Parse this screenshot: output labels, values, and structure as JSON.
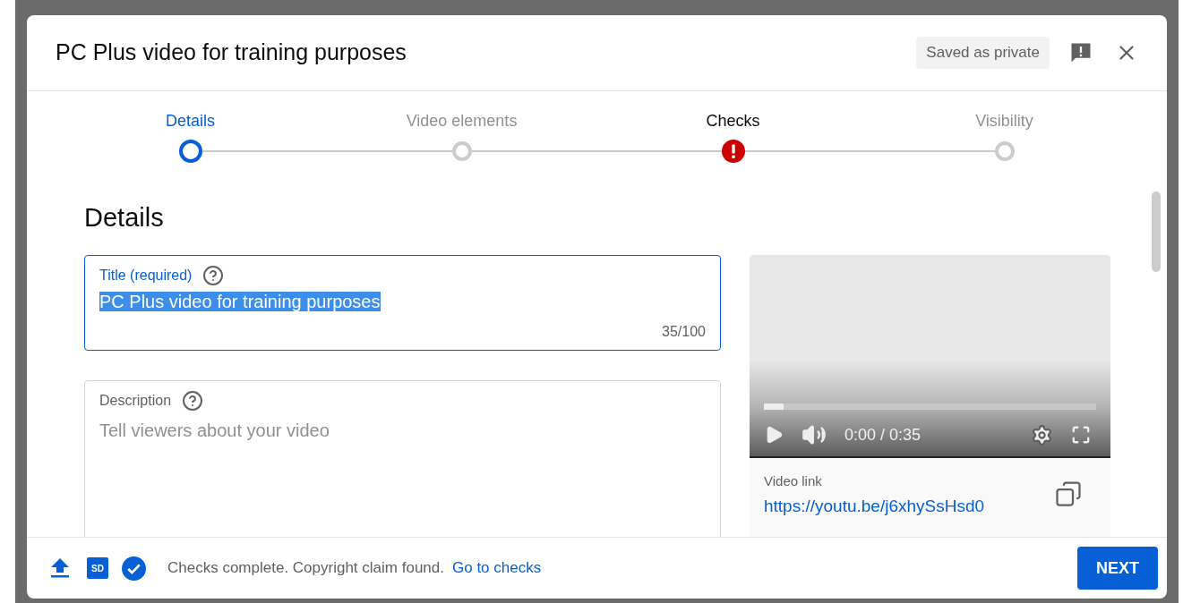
{
  "dialog": {
    "title": "PC Plus video for training purposes",
    "save_status": "Saved as private"
  },
  "steps": [
    {
      "label": "Details",
      "kind": "current"
    },
    {
      "label": "Video elements",
      "kind": "pending"
    },
    {
      "label": "Checks",
      "kind": "error"
    },
    {
      "label": "Visibility",
      "kind": "pending"
    }
  ],
  "section_heading": "Details",
  "title_field": {
    "label": "Title (required)",
    "value": "PC Plus video for training purposes",
    "counter": "35/100",
    "focused": true,
    "highlighted": true
  },
  "description_field": {
    "label": "Description",
    "placeholder": "Tell viewers about your video"
  },
  "preview": {
    "time": "0:00 / 0:35",
    "level": 0.06,
    "link_label": "Video link",
    "link": "https://youtu.be/j6xhySsHsd0"
  },
  "footer": {
    "sd_badge": "SD",
    "status": "Checks complete. Copyright claim found.",
    "link": "Go to checks",
    "next": "NEXT"
  }
}
